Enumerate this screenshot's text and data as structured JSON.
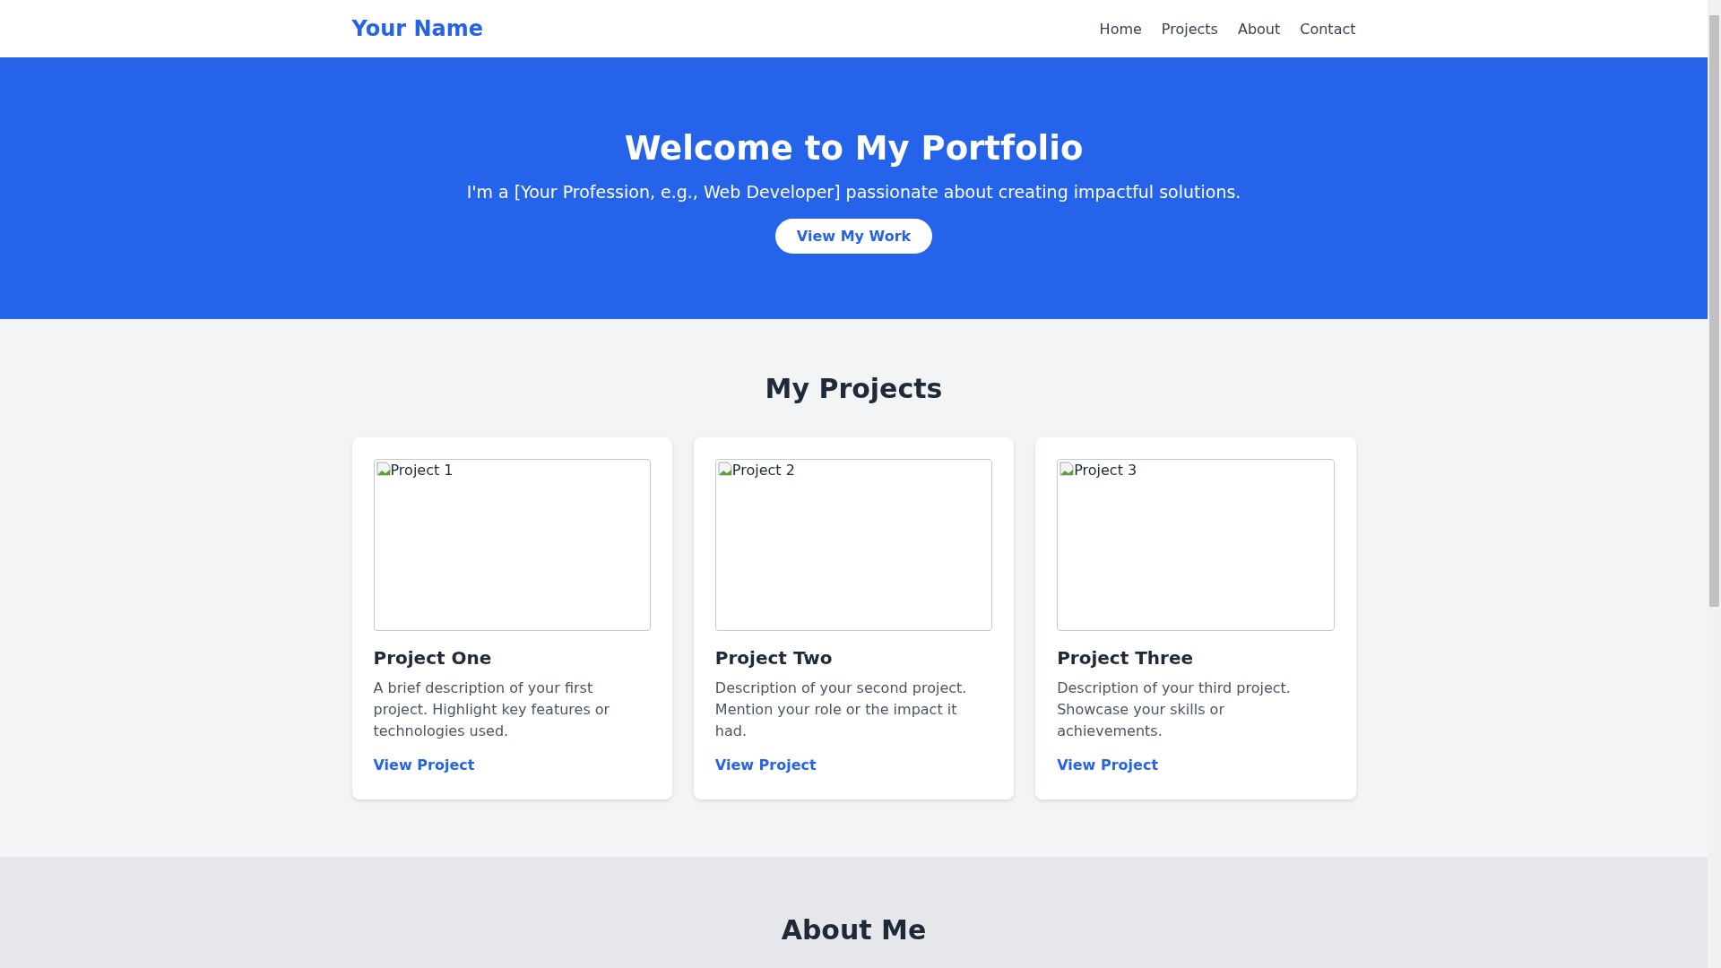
{
  "header": {
    "brand": "Your Name",
    "nav": [
      "Home",
      "Projects",
      "About",
      "Contact"
    ]
  },
  "hero": {
    "title": "Welcome to My Portfolio",
    "subtitle": "I'm a [Your Profession, e.g., Web Developer] passionate about creating impactful solutions.",
    "button": "View My Work"
  },
  "projects": {
    "heading": "My Projects",
    "cards": [
      {
        "image_alt": "Project 1",
        "title": "Project One",
        "description": "A brief description of your first project. Highlight key features or technologies used.",
        "link": "View Project"
      },
      {
        "image_alt": "Project 2",
        "title": "Project Two",
        "description": "Description of your second project. Mention your role or the impact it had.",
        "link": "View Project"
      },
      {
        "image_alt": "Project 3",
        "title": "Project Three",
        "description": "Description of your third project. Showcase your skills or achievements.",
        "link": "View Project"
      }
    ]
  },
  "about": {
    "heading": "About Me"
  }
}
